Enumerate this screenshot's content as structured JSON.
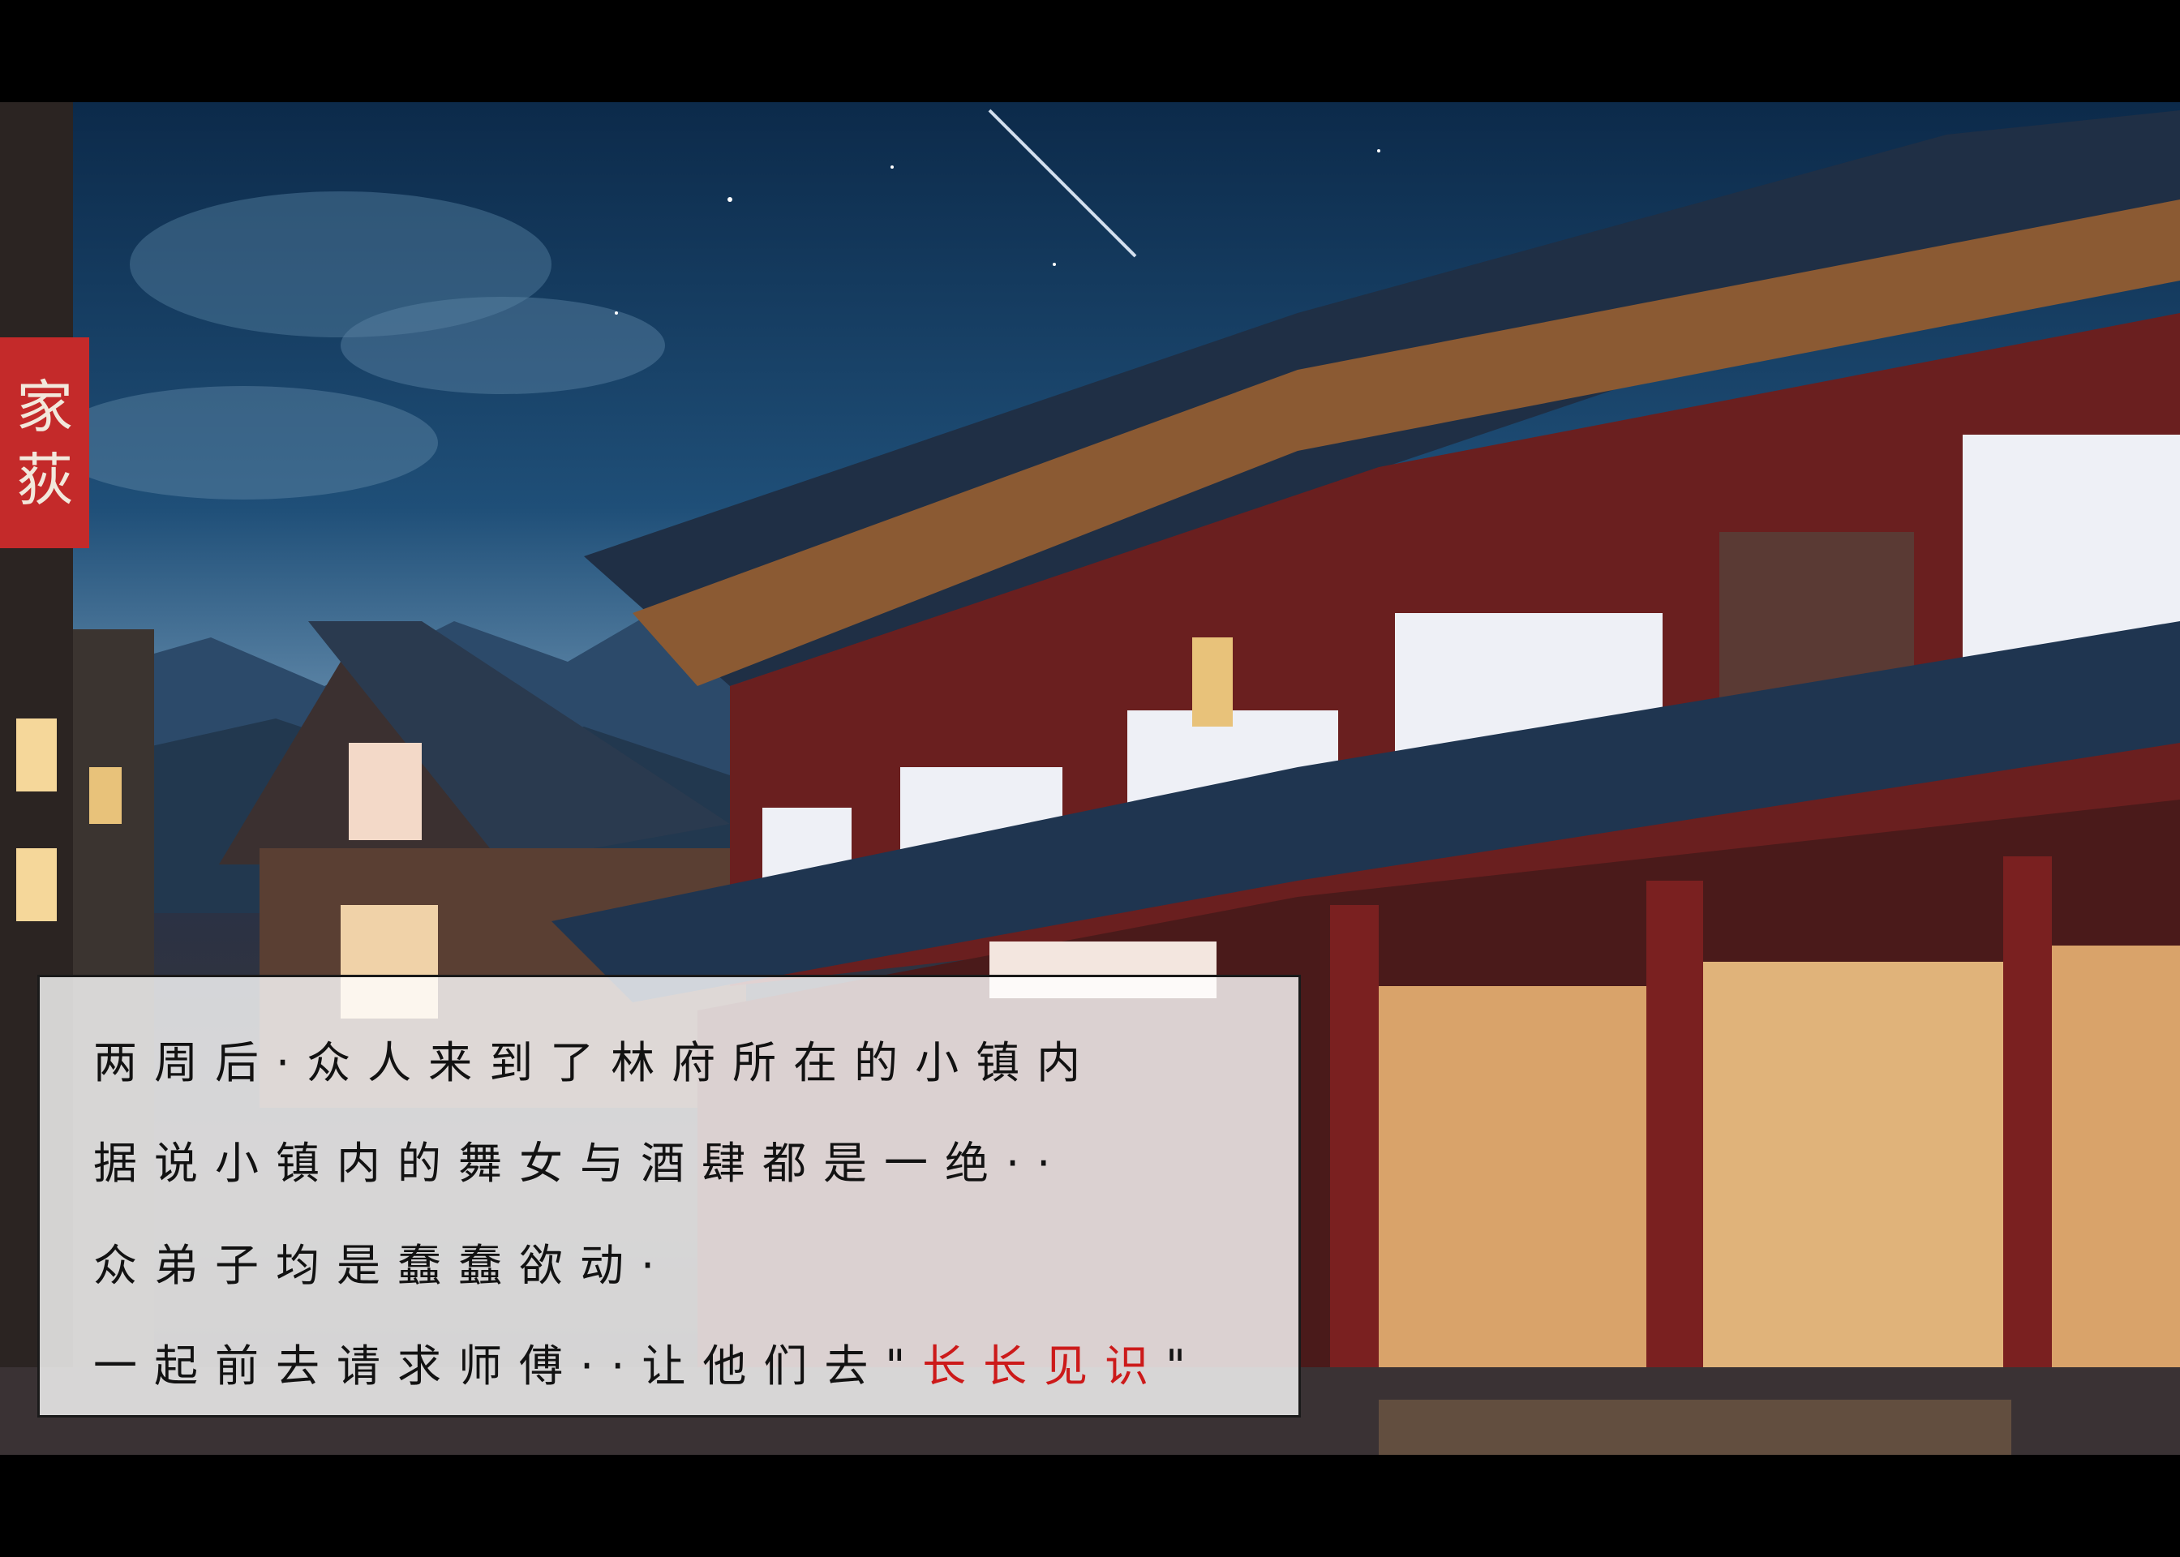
{
  "dialogue": {
    "line1": "两周后·众人来到了林府所在的小镇内",
    "line2": "据说小镇内的舞女与酒肆都是一绝··",
    "line3": "众弟子均是蠢蠢欲动·",
    "line4_prefix": "一起前去请求师傅··让他们去\"",
    "line4_highlight": "长长见识",
    "line4_suffix": "\""
  },
  "colors": {
    "highlight": "#cc1a1a",
    "dialogue_text": "#121212",
    "dialogue_box": "#ffffff"
  }
}
